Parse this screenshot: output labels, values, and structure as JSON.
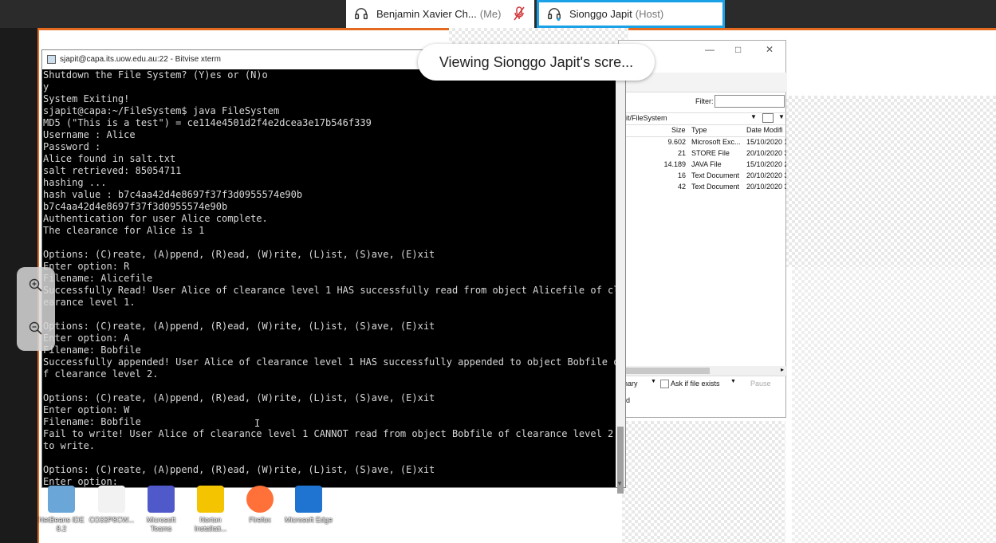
{
  "meeting": {
    "participants": [
      {
        "name": "Benjamin Xavier Ch...",
        "role": "(Me)",
        "muted": true
      },
      {
        "name": "Sionggo Japit",
        "role": "(Host)",
        "active_speaker": true
      }
    ],
    "viewing_banner": "Viewing Sionggo Japit's scre...",
    "accent_color": "#1aa1e6",
    "share_border_color": "#e36a1e"
  },
  "xterm": {
    "title": "sjapit@capa.its.uow.edu.au:22 - Bitvise xterm",
    "lines": [
      "Shutdown the File System? (Y)es or (N)o",
      "y",
      "System Exiting!",
      "sjapit@capa:~/FileSystem$ java FileSystem",
      "MD5 (\"This is a test\") = ce114e4501d2f4e2dcea3e17b546f339",
      "Username : Alice",
      "Password :",
      "Alice found in salt.txt",
      "salt retrieved: 85054711",
      "hashing ...",
      "hash value : b7c4aa42d4e8697f37f3d0955574e90b",
      "b7c4aa42d4e8697f37f3d0955574e90b",
      "Authentication for user Alice complete.",
      "The clearance for Alice is 1",
      "",
      "Options: (C)reate, (A)ppend, (R)ead, (W)rite, (L)ist, (S)ave, (E)xit",
      "Enter option: R",
      "Filename: Alicefile",
      "Successfully Read! User Alice of clearance level 1 HAS successfully read from object Alicefile of cl",
      "earance level 1.",
      "",
      "Options: (C)reate, (A)ppend, (R)ead, (W)rite, (L)ist, (S)ave, (E)xit",
      "Enter option: A",
      "Filename: Bobfile",
      "Successfully appended! User Alice of clearance level 1 HAS successfully appended to object Bobfile o",
      "f clearance level 2.",
      "",
      "Options: (C)reate, (A)ppend, (R)ead, (W)rite, (L)ist, (S)ave, (E)xit",
      "Enter option: W",
      "Filename: Bobfile",
      "Fail to write! User Alice of clearance level 1 CANNOT read from object Bobfile of clearance level 2",
      "to write.",
      "",
      "Options: (C)reate, (A)ppend, (R)ead, (W)rite, (L)ist, (S)ave, (E)xit",
      "Enter option:"
    ]
  },
  "explorer": {
    "filter_label": "Filter:",
    "path": "pit/FileSystem",
    "columns": {
      "size": "Size",
      "type": "Type",
      "date": "Date Modifi"
    },
    "rows": [
      {
        "size": "9.602",
        "type": "Microsoft Exc...",
        "date": "15/10/2020 1"
      },
      {
        "size": "21",
        "type": "STORE File",
        "date": "20/10/2020 3"
      },
      {
        "size": "14.189",
        "type": "JAVA File",
        "date": "15/10/2020 2"
      },
      {
        "size": "16",
        "type": "Text Document",
        "date": "20/10/2020 3"
      },
      {
        "size": "42",
        "type": "Text Document",
        "date": "20/10/2020 3"
      }
    ],
    "bottom": {
      "mode": "inary",
      "if_exists": "Ask if file exists",
      "pause": "Pause"
    },
    "status": "ed"
  },
  "desktop_icons": [
    {
      "label": "NetBeans IDE 8.2",
      "color": "#6aa7d8"
    },
    {
      "label": "CO33P8CW...",
      "color": "#f2f2f2"
    },
    {
      "label": "Microsoft Teams",
      "color": "#5059c9"
    },
    {
      "label": "Norton Installati...",
      "color": "#f5c400"
    },
    {
      "label": "Firefox",
      "color": "#ff7139"
    },
    {
      "label": "Microsoft Edge",
      "color": "#1e74d0"
    }
  ]
}
